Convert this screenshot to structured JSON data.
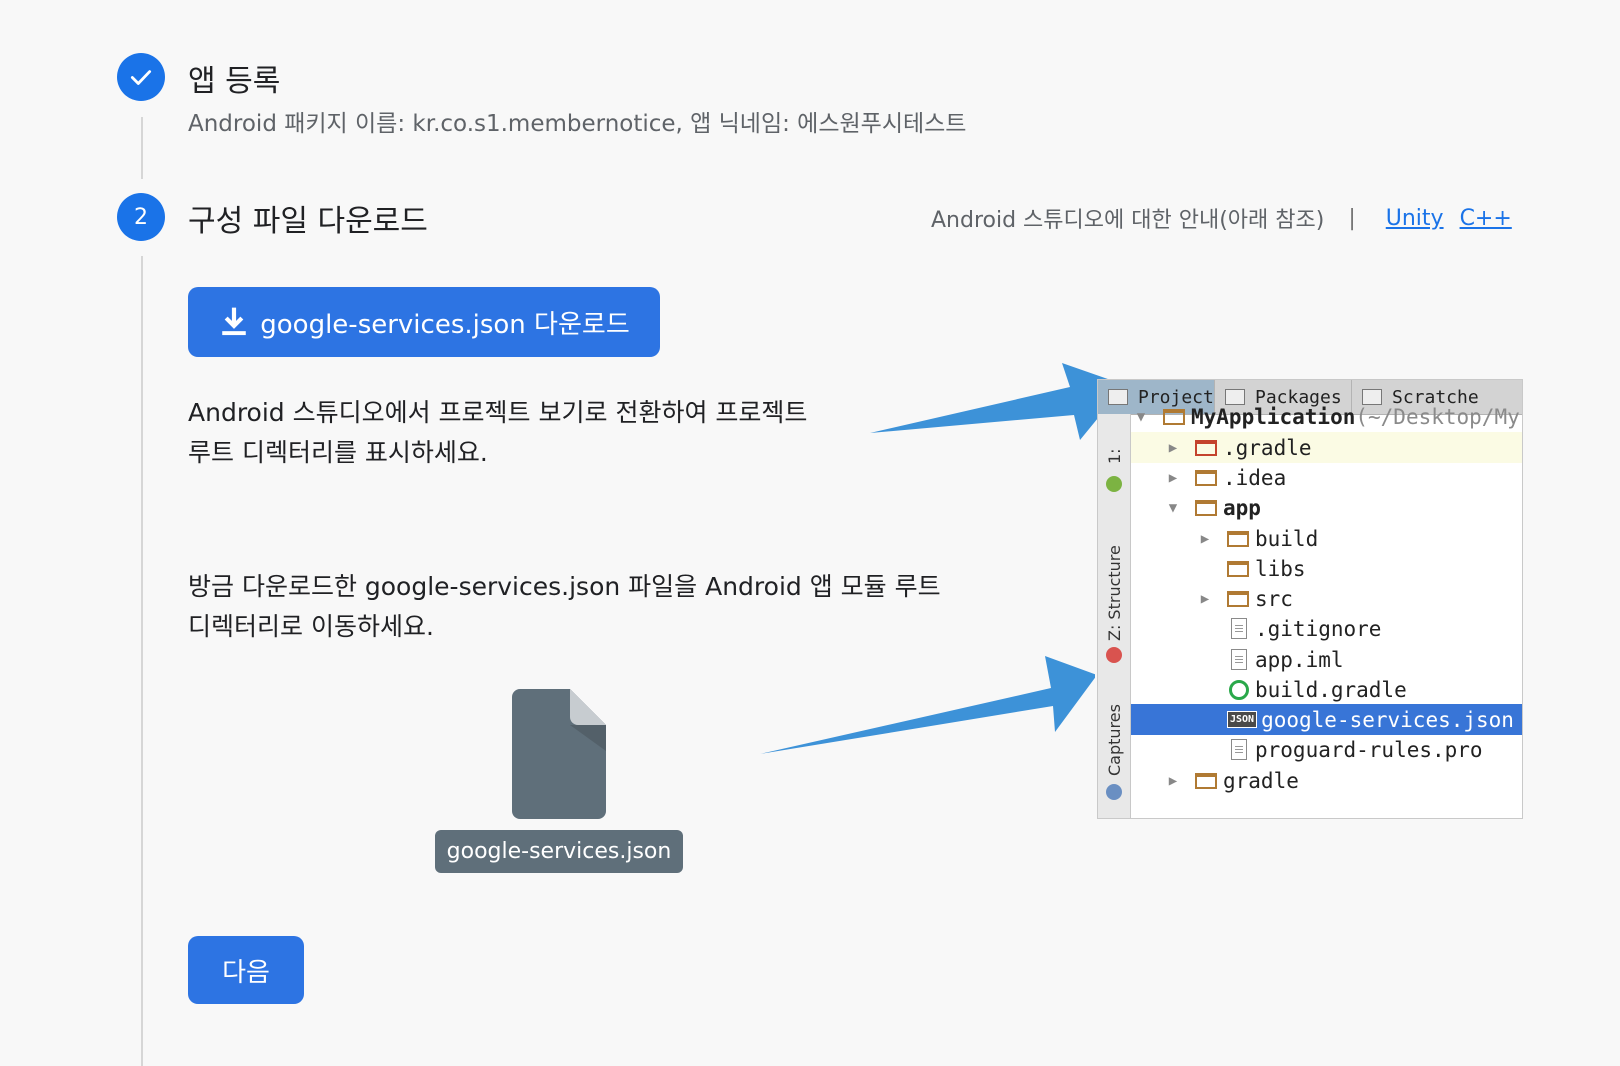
{
  "step1": {
    "number_icon": "check-icon",
    "title": "앱 등록",
    "subtitle": "Android 패키지 이름: kr.co.s1.membernotice, 앱 닉네임: 에스원푸시테스트"
  },
  "step2": {
    "number": "2",
    "title": "구성 파일 다운로드",
    "guide_text": "Android 스튜디오에 대한 안내(아래 참조)",
    "separator": "|",
    "link_unity": "Unity",
    "link_cpp": "C++",
    "download_button": "google-services.json 다운로드",
    "instruction1_line1": "Android 스튜디오에서 프로젝트 보기로 전환하여 프로젝트",
    "instruction1_line2": "루트 디렉터리를 표시하세요.",
    "instruction2_line1": "방금 다운로드한 google-services.json 파일을 Android 앱 모듈 루트",
    "instruction2_line2": "디렉터리로 이동하세요.",
    "file_chip": "google-services.json",
    "next_button": "다음"
  },
  "ide": {
    "tabs": [
      "Project",
      "Packages",
      "Scratche"
    ],
    "strip_labels": [
      "1:",
      "Z: Structure",
      "Captures"
    ],
    "tree": [
      {
        "label": "MyApplication",
        "suffix": " (~/Desktop/My"
      },
      {
        "label": ".gradle"
      },
      {
        "label": ".idea"
      },
      {
        "label": "app"
      },
      {
        "label": "build"
      },
      {
        "label": "libs"
      },
      {
        "label": "src"
      },
      {
        "label": ".gitignore"
      },
      {
        "label": "app.iml"
      },
      {
        "label": "build.gradle"
      },
      {
        "label": "google-services.json",
        "icon_text": "JSON"
      },
      {
        "label": "proguard-rules.pro"
      },
      {
        "label": "gradle"
      }
    ]
  },
  "colors": {
    "primary": "#1a73e8",
    "button": "#2d74e3",
    "arrow": "#3d92d8",
    "selection": "#3875d7"
  }
}
